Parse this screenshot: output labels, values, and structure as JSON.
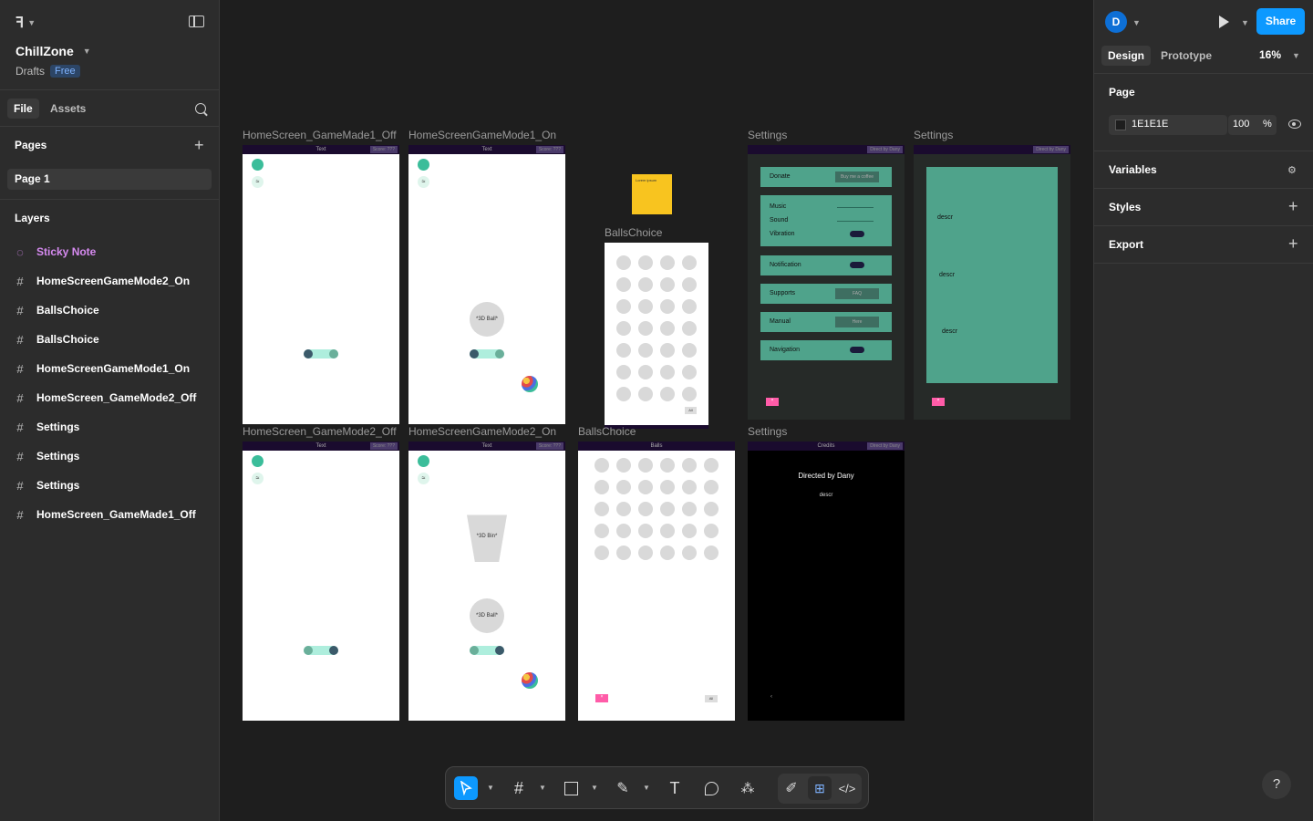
{
  "left_panel": {
    "project_name": "ChillZone",
    "location": "Drafts",
    "plan_badge": "Free",
    "tabs": [
      "File",
      "Assets"
    ],
    "pages_heading": "Pages",
    "pages": [
      "Page 1"
    ],
    "layers_heading": "Layers",
    "layers": [
      {
        "name": "Sticky Note",
        "type": "sticky"
      },
      {
        "name": "HomeScreenGameMode2_On",
        "type": "frame"
      },
      {
        "name": "BallsChoice",
        "type": "frame"
      },
      {
        "name": "BallsChoice",
        "type": "frame"
      },
      {
        "name": "HomeScreenGameMode1_On",
        "type": "frame"
      },
      {
        "name": "HomeScreen_GameMode2_Off",
        "type": "frame"
      },
      {
        "name": "Settings",
        "type": "frame"
      },
      {
        "name": "Settings",
        "type": "frame"
      },
      {
        "name": "Settings",
        "type": "frame"
      },
      {
        "name": "HomeScreen_GameMade1_Off",
        "type": "frame"
      }
    ]
  },
  "canvas": {
    "frame_labels": {
      "f1": "HomeScreen_GameMade1_Off",
      "f2": "HomeScreenGameMode1_On",
      "f3": "BallsChoice",
      "f4": "Settings",
      "f5": "Settings",
      "f6": "HomeScreen_GameMode2_Off",
      "f7": "HomeScreenGameMode2_On",
      "f8": "BallsChoice",
      "f9": "Settings"
    },
    "frame_bar_text": "Text",
    "frame_bar_tag": "Score: ???",
    "ball_text": "*3D Ball*",
    "bin_text": "*3D Bin*",
    "balls_bar": "Balls",
    "credits_bar": "Credits",
    "credits_tag": "Direct by Dany",
    "credits_title": "Directed by Dany",
    "credits_desc": "descr",
    "settings_tag": "Direct by Dany",
    "settings_rows": {
      "donate": "Donate",
      "donate_btn": "Buy me a coffee",
      "music": "Music",
      "sound": "Sound",
      "vibration": "Vibration",
      "notification": "Notification",
      "supports": "Supports",
      "supports_btn": "FAQ",
      "manual": "Manual",
      "manual_btn": "Here",
      "navigation": "Navigation"
    },
    "descr": [
      "descr",
      "descr",
      "descr"
    ],
    "sticky_text": "Lorem ipsum",
    "ok_label": "All"
  },
  "toolbar": {
    "tools": [
      "move-tool",
      "frame-tool",
      "shape-tool",
      "pen-tool",
      "text-tool",
      "comment-tool",
      "actions-tool"
    ],
    "text_tool_glyph": "T"
  },
  "right_panel": {
    "avatar_initial": "D",
    "share_label": "Share",
    "tabs": [
      "Design",
      "Prototype"
    ],
    "zoom": "16%",
    "page_heading": "Page",
    "bg_color": "1E1E1E",
    "bg_opacity": "100",
    "percent_sign": "%",
    "sections": [
      "Variables",
      "Styles",
      "Export"
    ],
    "help": "?"
  }
}
